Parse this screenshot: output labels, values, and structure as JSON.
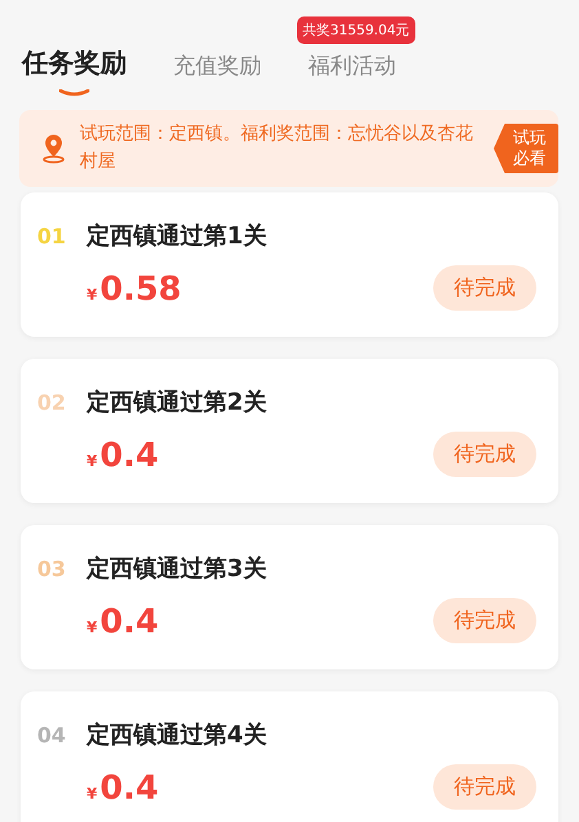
{
  "tabs": [
    {
      "label": "任务奖励",
      "selected": true
    },
    {
      "label": "充值奖励",
      "selected": false
    },
    {
      "label": "福利活动",
      "selected": false,
      "badge": "共奖31559.04元"
    }
  ],
  "notice": {
    "text": "试玩范围：定西镇。福利奖范围：忘忧谷以及杏花村屋",
    "tag": "试玩必看"
  },
  "tasks": [
    {
      "rank": "01",
      "color": "#f5d442",
      "title": "定西镇通过第1关",
      "currency": "¥",
      "amount": "0.58",
      "status": "待完成"
    },
    {
      "rank": "02",
      "color": "#f8d2b0",
      "title": "定西镇通过第2关",
      "currency": "¥",
      "amount": "0.4",
      "status": "待完成"
    },
    {
      "rank": "03",
      "color": "#f6c89a",
      "title": "定西镇通过第3关",
      "currency": "¥",
      "amount": "0.4",
      "status": "待完成"
    },
    {
      "rank": "04",
      "color": "#b5b5b5",
      "title": "定西镇通过第4关",
      "currency": "¥",
      "amount": "0.4",
      "status": "待完成"
    }
  ]
}
